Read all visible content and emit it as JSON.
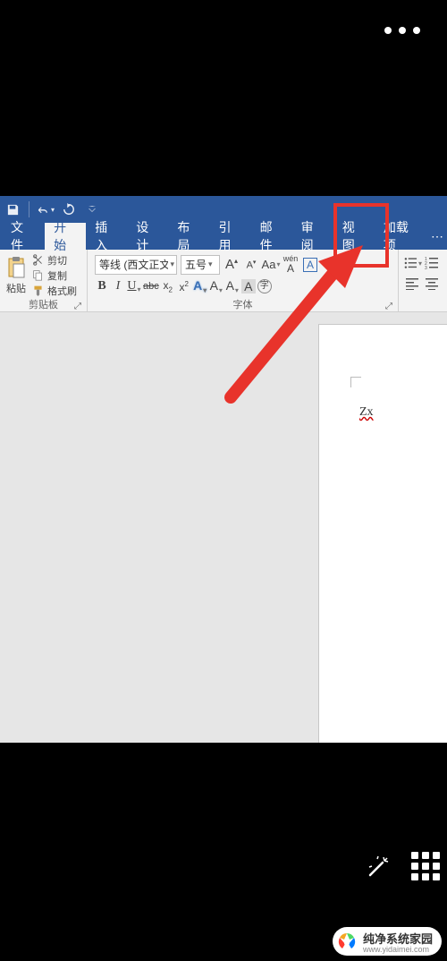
{
  "qat": {
    "save_icon": "save-icon",
    "undo_icon": "undo-icon",
    "redo_icon": "redo-icon"
  },
  "tabs": {
    "file": "文件",
    "home": "开始",
    "insert": "插入",
    "design": "设计",
    "layout": "布局",
    "references": "引用",
    "mailings": "邮件",
    "review": "审阅",
    "view": "视图",
    "addins": "加载项"
  },
  "clipboard": {
    "cut": "剪切",
    "copy": "复制",
    "format_painter": "格式刷",
    "paste": "粘贴",
    "group_label": "剪贴板"
  },
  "font": {
    "name": "等线 (西文正文)",
    "size": "五号",
    "grow": "A",
    "shrink": "A",
    "phonetic": "wén",
    "bold": "B",
    "italic": "I",
    "underline": "U",
    "strike": "abc",
    "sub": "x₂",
    "sup": "x²",
    "texteffect": "A",
    "highlight": "A",
    "fontcolor": "A",
    "charshade": "A",
    "group_label": "字体"
  },
  "document": {
    "text": "Zx"
  },
  "watermark": {
    "title": "纯净系统家园",
    "url": "www.yidaimei.com"
  }
}
